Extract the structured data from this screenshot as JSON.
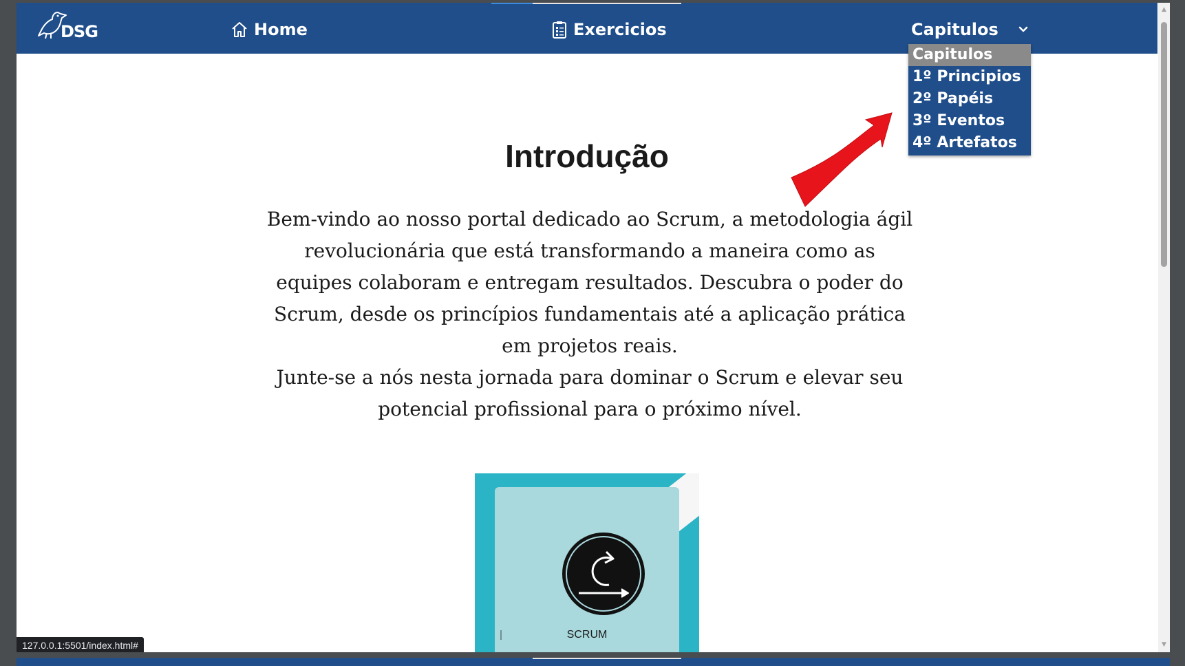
{
  "navbar": {
    "logo_text": "DSG",
    "home_label": "Home",
    "home_icon": "house-icon",
    "exercicios_label": "Exercicios",
    "exercicios_icon": "clipboard-list-icon",
    "capitulos_label": "Capitulos",
    "capitulos_chevron": "chevron-down-icon",
    "background_color": "#1f4e8a"
  },
  "dropdown": {
    "items": [
      {
        "label": "Capitulos",
        "selected": true
      },
      {
        "label": "1º Principios",
        "selected": false
      },
      {
        "label": "2º Papéis",
        "selected": false
      },
      {
        "label": "3º Eventos",
        "selected": false
      },
      {
        "label": "4º Artefatos",
        "selected": false
      }
    ],
    "selected_color": "#8a8a8a"
  },
  "annotation": {
    "arrow_color": "#e8141b"
  },
  "main": {
    "title": "Introdução",
    "paragraph_1": "Bem-vindo ao nosso portal dedicado ao Scrum, a metodologia ágil revolucionária que está transformando a maneira como as equipes colaboram e entregam resultados. Descubra o poder do Scrum, desde os princípios fundamentais até a aplicação prática em projetos reais.",
    "paragraph_2": "Junte-se a nós nesta jornada para dominar o Scrum e elevar seu potencial profissional para o próximo nível.",
    "image_label": "SCRUM",
    "image_color": "#2bb4c6"
  },
  "status_bar": {
    "url": "127.0.0.1:5501/index.html#"
  }
}
